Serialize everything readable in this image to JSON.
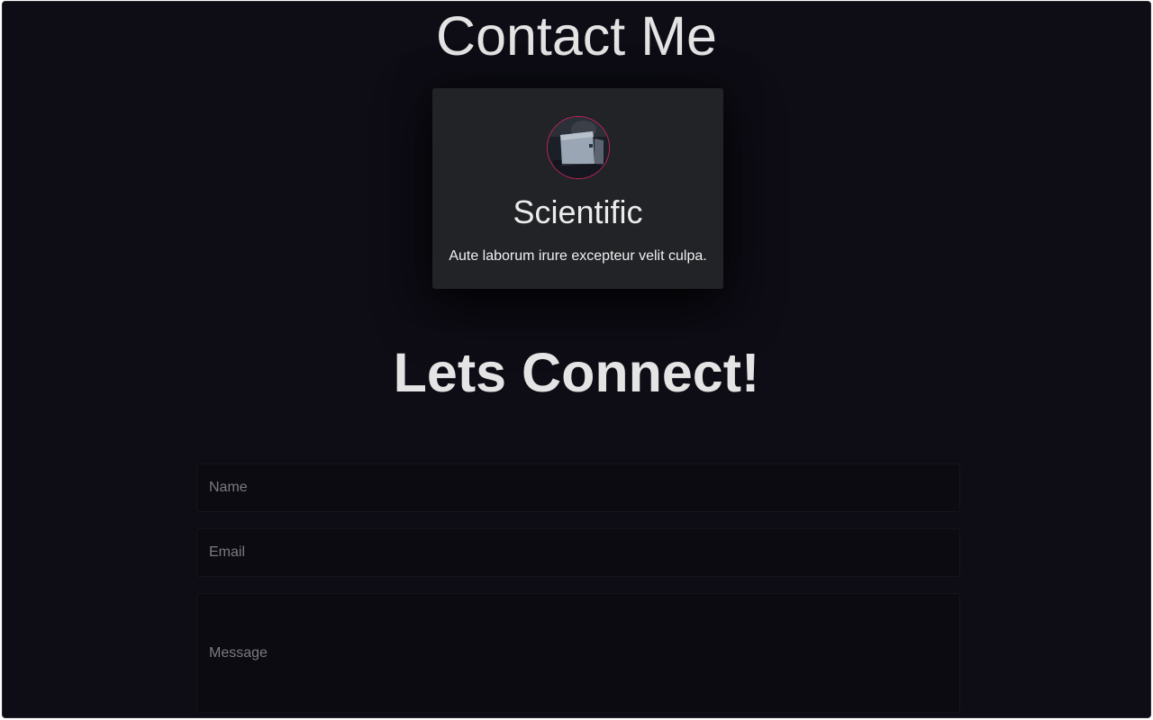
{
  "page": {
    "title": "Contact Me"
  },
  "card": {
    "avatar_icon": "laptop-photo-avatar",
    "title": "Scientific",
    "text": "Aute laborum irure excepteur velit culpa."
  },
  "connect": {
    "title": "Lets Connect!"
  },
  "form": {
    "name": {
      "value": "",
      "placeholder": "Name"
    },
    "email": {
      "value": "",
      "placeholder": "Email"
    },
    "message": {
      "value": "",
      "placeholder": "Message"
    }
  },
  "colors": {
    "background": "#0e0d16",
    "card_background": "#212326",
    "avatar_border": "#c0245a",
    "text": "#e4e4e4",
    "input_background": "#0b0b11",
    "placeholder": "#7a7a80"
  }
}
